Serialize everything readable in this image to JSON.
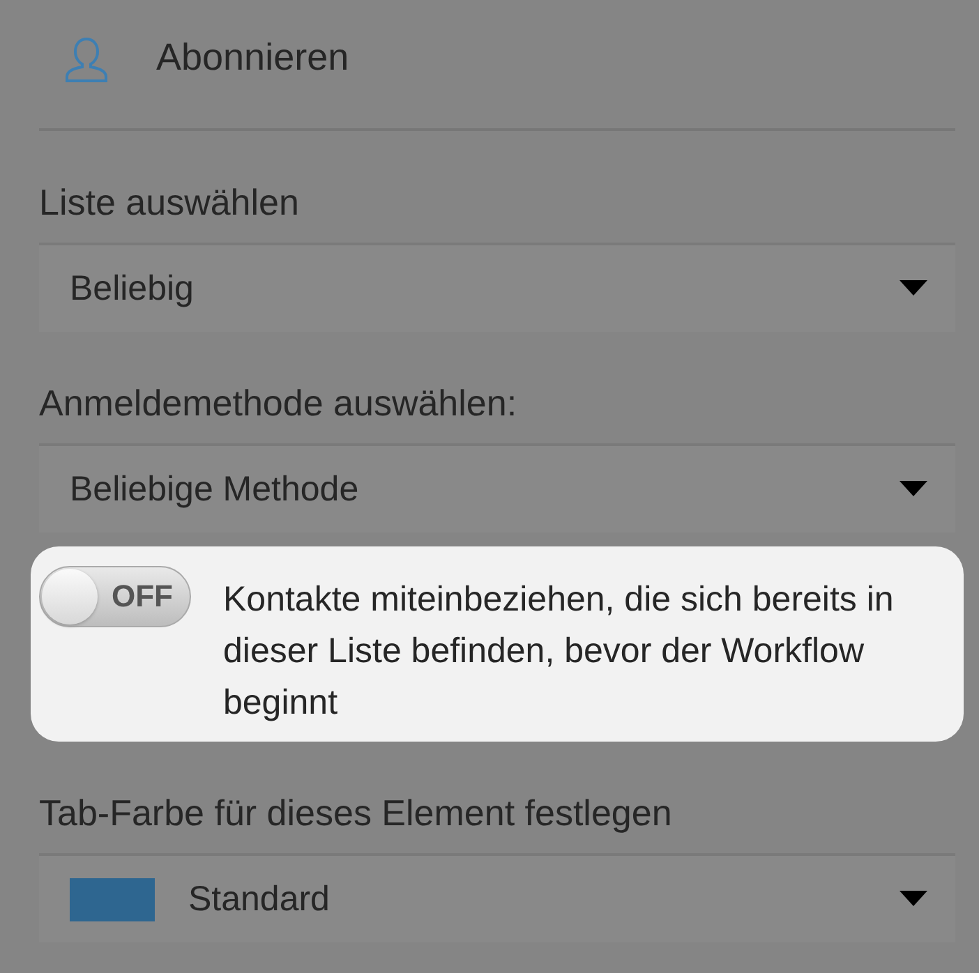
{
  "header": {
    "title": "Abonnieren"
  },
  "sections": [
    {
      "kind": "select",
      "label": "Liste auswählen",
      "value": "Beliebig"
    },
    {
      "kind": "select",
      "label": "Anmeldemethode auswählen:",
      "value": "Beliebige Methode"
    },
    {
      "kind": "toggle",
      "on": false,
      "switch_text": "OFF",
      "text": "Kontakte miteinbeziehen, die sich bereits in dieser Liste befinden, bevor der Workflow beginnt"
    },
    {
      "kind": "color_select",
      "label": "Tab-Farbe für dieses Element festlegen",
      "value": "Standard",
      "color": "#2e6690"
    }
  ]
}
